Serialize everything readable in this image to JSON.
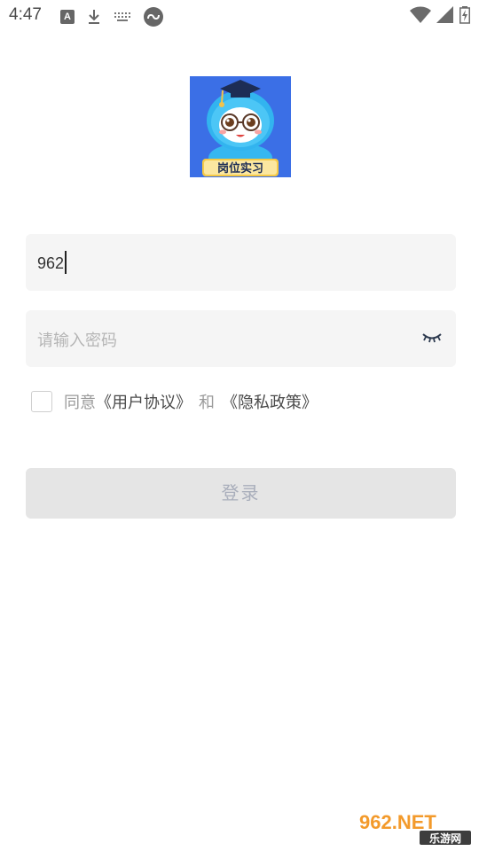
{
  "status_bar": {
    "time": "4:47",
    "icons": [
      "font-a-icon",
      "download-icon",
      "keyboard-icon",
      "sync-icon",
      "wifi-icon",
      "signal-icon",
      "battery-icon"
    ],
    "notif_letter": "A"
  },
  "logo": {
    "badge_text": "岗位实习",
    "bg_color": "#3b6fe6"
  },
  "form": {
    "username_value": "962",
    "password_placeholder": "请输入密码",
    "agree_prefix": "同意",
    "user_agreement": "《用户协议》",
    "and_text": "和",
    "privacy_policy": "《隐私政策》",
    "login_label": "登录"
  },
  "watermark": {
    "brand": "962.NET",
    "sub": "乐游网"
  }
}
